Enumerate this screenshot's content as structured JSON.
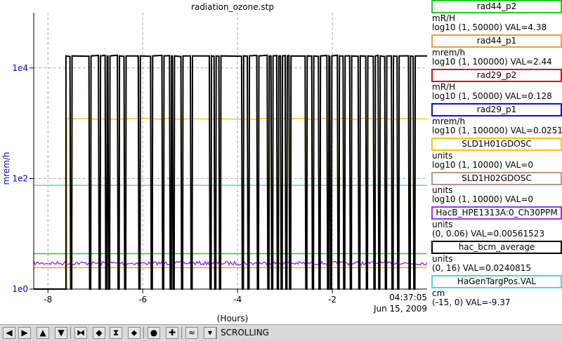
{
  "chart_data": {
    "type": "line",
    "title": "radiation_ozone.stp",
    "ylabel": "mrem/h",
    "xlabel": "(Hours)",
    "yscale": "log",
    "ylim": [
      1,
      100000
    ],
    "xlim": [
      -8.3,
      0
    ],
    "y_ticks": [
      {
        "value": 1,
        "label": "1e0"
      },
      {
        "value": 100,
        "label": "1e2"
      },
      {
        "value": 10000,
        "label": "1e4"
      }
    ],
    "x_ticks": [
      {
        "value": -8,
        "label": "-8"
      },
      {
        "value": -6,
        "label": "-6"
      },
      {
        "value": -4,
        "label": "-4"
      },
      {
        "value": -2,
        "label": "-2"
      }
    ],
    "end_time": "04:37:05",
    "end_date": "Jun 15, 2009",
    "grid": true,
    "legend_position": "right",
    "dropouts": [
      -7.62,
      -7.52,
      -7.12,
      -6.92,
      -6.78,
      -6.72,
      -6.52,
      -6.38,
      -6.08,
      -5.82,
      -5.58,
      -5.42,
      -5.36,
      -5.18,
      -4.98,
      -4.58,
      -4.48,
      -4.38,
      -3.9,
      -3.78,
      -3.58,
      -3.36,
      -3.28,
      -3.16,
      -3.08,
      -2.98,
      -2.9,
      -2.56,
      -2.42,
      -2.28,
      -2.1,
      -2.04,
      -1.88,
      -1.76,
      -1.62,
      -1.44,
      -1.28,
      -1.12,
      -1.02,
      -0.88,
      -0.74,
      -0.62,
      -0.38,
      -0.28
    ],
    "series": [
      {
        "name": "rad44_p2",
        "color": "#22cc22",
        "value": 4.38,
        "shape": "flat"
      },
      {
        "name": "rad44_p1",
        "color": "#f09a3a",
        "value": 2.44,
        "shape": "flat"
      },
      {
        "name": "rad29_p2",
        "color": "#dd1111",
        "value": 0.128,
        "shape": "flat"
      },
      {
        "name": "rad29_p1",
        "color": "#1111cc",
        "value": 0.0251,
        "shape": "flat"
      },
      {
        "name": "SLD1H01GDOSC",
        "color": "#f5c800",
        "baseline": 1200,
        "onset": -7.6,
        "shape": "stepped"
      },
      {
        "name": "SLD1H02GDOSC",
        "color": "#c09090",
        "value": 0,
        "shape": "flat"
      },
      {
        "name": "HacB_HPE1313A:0_Ch30PPM",
        "color": "#9933ee",
        "value": 0.00561523,
        "shape": "noisy"
      },
      {
        "name": "hac_bcm_average",
        "color": "#000000",
        "baseline": 16500,
        "onset": -7.62,
        "shape": "stepped"
      },
      {
        "name": "HaGenTargPos.VAL",
        "color": "#44ddcc",
        "value": -9.37,
        "shape": "flat"
      }
    ]
  },
  "legend": [
    {
      "name": "rad44_p2",
      "color": "#22cc22",
      "unit": "mR/H",
      "range": "log10 (1, 50000) VAL=4.38"
    },
    {
      "name": "rad44_p1",
      "color": "#f09a3a",
      "unit": "mrem/h",
      "range": "log10 (1, 100000) VAL=2.44"
    },
    {
      "name": "rad29_p2",
      "color": "#dd1111",
      "unit": "mR/H",
      "range": "log10 (1, 50000) VAL=0.128"
    },
    {
      "name": "rad29_p1",
      "color": "#1111cc",
      "unit": "mrem/h",
      "range": "log10 (1, 100000) VAL=0.0251"
    },
    {
      "name": "SLD1H01GDOSC",
      "color": "#f5c800",
      "unit": "units",
      "range": "log10 (1, 10000) VAL=0"
    },
    {
      "name": "SLD1H02GDOSC",
      "color": "#c09090",
      "unit": "units",
      "range": "log10 (1, 10000) VAL=0"
    },
    {
      "name": "HacB_HPE1313A:0_Ch30PPM",
      "color": "#9933ee",
      "unit": "units",
      "range": "(0, 0.06) VAL=0.00561523"
    },
    {
      "name": "hac_bcm_average",
      "color": "#000000",
      "unit": "units",
      "range": "(0, 16) VAL=0.0240815"
    },
    {
      "name": "HaGenTargPos.VAL",
      "color": "#44ddcc",
      "unit": "cm",
      "range": "(-15, 0) VAL=-9.37"
    }
  ],
  "toolbar": {
    "buttons": [
      {
        "name": "pan-left-button",
        "icon": "arrow-left-icon",
        "glyph": "◀"
      },
      {
        "name": "pan-right-button",
        "icon": "arrow-right-icon",
        "glyph": "▶"
      },
      {
        "name": "pan-up-button",
        "icon": "arrow-up-icon",
        "glyph": "▲"
      },
      {
        "name": "pan-down-button",
        "icon": "arrow-down-icon",
        "glyph": "▼"
      },
      {
        "name": "zoom-in-x-button",
        "icon": "zoom-in-x-icon",
        "glyph": "⧓"
      },
      {
        "name": "zoom-out-x-button",
        "icon": "zoom-out-x-icon",
        "glyph": "◆"
      },
      {
        "name": "zoom-in-y-button",
        "icon": "zoom-in-y-icon",
        "glyph": "⧗"
      },
      {
        "name": "zoom-out-y-button",
        "icon": "zoom-out-y-icon",
        "glyph": "⬥"
      },
      {
        "name": "autoscale-button",
        "icon": "circle-icon",
        "glyph": "●"
      },
      {
        "name": "crosshair-button",
        "icon": "plus-icon",
        "glyph": "✚"
      },
      {
        "name": "scroll-mode-button",
        "icon": "scroll-icon",
        "glyph": "≈"
      },
      {
        "name": "dropdown-button",
        "icon": "chevron-down-icon",
        "glyph": "▾"
      }
    ],
    "status": "SCROLLING"
  }
}
